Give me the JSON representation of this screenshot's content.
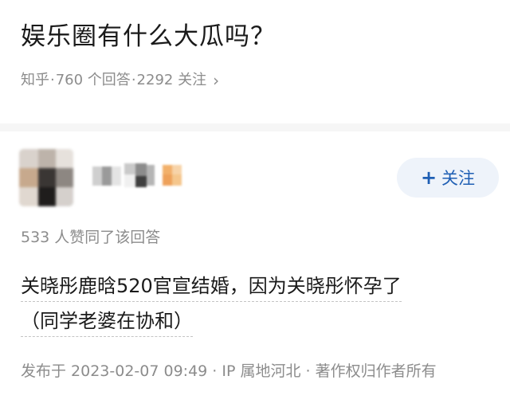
{
  "question": {
    "title": "娱乐圈有什么大瓜吗？",
    "source": "知乎",
    "answers": "760 个回答",
    "followers": "2292 关注",
    "chevron_icon": "chevron-right-icon"
  },
  "answer": {
    "follow_button": {
      "icon": "plus-icon",
      "label": "关注"
    },
    "vote_count": "533 人赞同了该回答",
    "content_line1": "关晓彤鹿晗520官宣结婚，因为关晓彤怀孕了",
    "content_line2": "（同学老婆在协和）",
    "publish_info": "发布于 2023-02-07 09:49 · IP 属地河北 · 著作权归作者所有"
  },
  "colors": {
    "text_primary": "#1a1a1a",
    "text_secondary": "#8c8c8c",
    "follow_bg": "#eef3fa",
    "follow_text": "#1f5fb4"
  }
}
